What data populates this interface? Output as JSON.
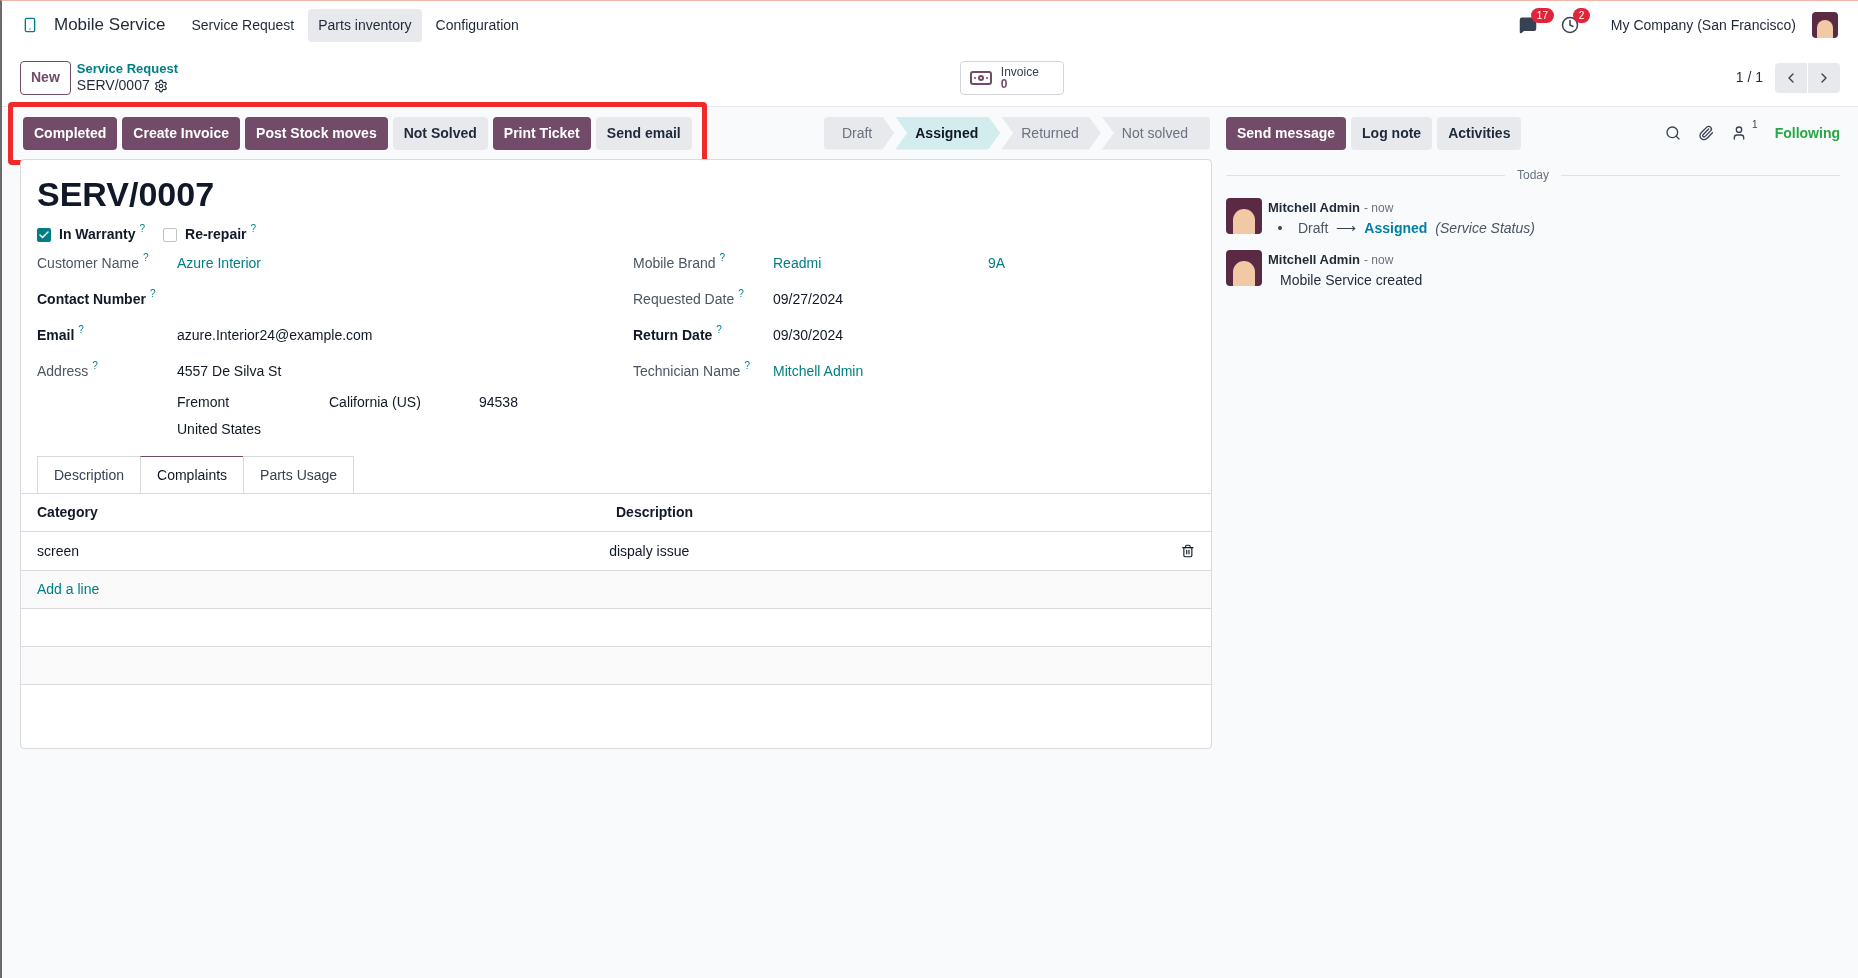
{
  "navbar": {
    "app_name": "Mobile Service",
    "menus": [
      {
        "label": "Service Request",
        "selected": false
      },
      {
        "label": "Parts inventory",
        "selected": true
      },
      {
        "label": "Configuration",
        "selected": false
      }
    ],
    "messages_badge": "17",
    "activities_badge": "2",
    "company": "My Company (San Francisco)"
  },
  "control_panel": {
    "new_button": "New",
    "breadcrumb": "Service Request",
    "record": "SERV/0007",
    "smart_button": {
      "label": "Invoice",
      "count": "0"
    },
    "pager": "1 / 1"
  },
  "actions": [
    {
      "label": "Completed",
      "primary": true
    },
    {
      "label": "Create Invoice",
      "primary": true
    },
    {
      "label": "Post Stock moves",
      "primary": true
    },
    {
      "label": "Not Solved",
      "primary": false
    },
    {
      "label": "Print Ticket",
      "primary": true
    },
    {
      "label": "Send email",
      "primary": false
    }
  ],
  "highlight": true,
  "statusbar": [
    {
      "label": "Draft",
      "selected": false
    },
    {
      "label": "Assigned",
      "selected": true
    },
    {
      "label": "Returned",
      "selected": false
    },
    {
      "label": "Not solved",
      "selected": false
    }
  ],
  "chatter_buttons": [
    {
      "label": "Send message",
      "primary": true
    },
    {
      "label": "Log note",
      "primary": false
    },
    {
      "label": "Activities",
      "primary": false
    }
  ],
  "followers_count": "1",
  "following": "Following",
  "form": {
    "title": "SERV/0007",
    "checkboxes": [
      {
        "label": "In Warranty",
        "help": "?",
        "checked": true
      },
      {
        "label": "Re-repair",
        "help": "?",
        "checked": false
      }
    ],
    "left_fields": [
      {
        "label": "Customer Name",
        "help": "?",
        "required": false,
        "kind": "link",
        "values": [
          "Azure Interior"
        ]
      },
      {
        "label": "Contact Number",
        "help": "?",
        "required": true,
        "kind": "text"
      },
      {
        "label": "Email",
        "help": "?",
        "required": true,
        "kind": "text",
        "values": [
          "azure.Interior24@example.com"
        ]
      },
      {
        "label": "Address",
        "help": "?",
        "required": false,
        "kind": "address",
        "values": [
          "4557 De Silva St",
          "Fremont",
          "California (US)",
          "94538",
          "United States"
        ]
      }
    ],
    "right_fields": [
      {
        "label": "Mobile Brand",
        "help": "?",
        "required": false,
        "kind": "link",
        "values": [
          "Readmi",
          "9A"
        ]
      },
      {
        "label": "Requested Date",
        "help": "?",
        "required": false,
        "kind": "text",
        "values": [
          "09/27/2024"
        ]
      },
      {
        "label": "Return Date",
        "help": "?",
        "required": true,
        "kind": "text",
        "values": [
          "09/30/2024"
        ]
      },
      {
        "label": "Technician Name",
        "help": "?",
        "required": false,
        "kind": "link",
        "values": [
          "Mitchell Admin"
        ]
      }
    ],
    "tabs": [
      {
        "label": "Description",
        "selected": false
      },
      {
        "label": "Complaints",
        "selected": true
      },
      {
        "label": "Parts Usage",
        "selected": false
      }
    ],
    "table": {
      "columns": [
        "Category",
        "Description"
      ],
      "rows": [
        [
          "screen",
          "dispaly issue"
        ]
      ],
      "add_line": "Add a line"
    }
  },
  "chatter": {
    "date_separator": "Today",
    "messages": [
      {
        "author": "Mitchell Admin",
        "time": "- now",
        "kind": "tracking",
        "old": "Draft",
        "arrow": "⟶",
        "new": "Assigned",
        "field": "(Service Status)"
      },
      {
        "author": "Mitchell Admin",
        "time": "- now",
        "kind": "text",
        "body": "Mobile Service created"
      }
    ]
  }
}
